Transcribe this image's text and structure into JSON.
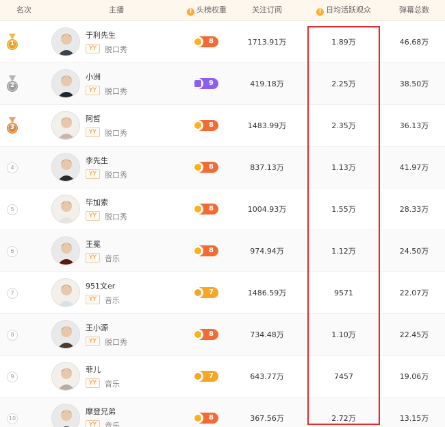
{
  "header": {
    "rank": "名次",
    "anchor": "主播",
    "weight": "头榜权重",
    "follow": "关注订阅",
    "viewers": "日均活跃观众",
    "danmu": "弹幕总数"
  },
  "colors": {
    "gold": "#e8a31c",
    "silver": "#9a9a9a",
    "bronze": "#d9853b",
    "highlight": "#e8262c"
  },
  "rows": [
    {
      "rank": "1",
      "medal": "gold",
      "name": "于利先生",
      "platform": "YY",
      "category": "脱口秀",
      "badge": "sun",
      "level": "8",
      "follow": "1713.91万",
      "viewers": "1.89万",
      "danmu": "46.68万"
    },
    {
      "rank": "2",
      "medal": "silver",
      "name": "小洲",
      "platform": "YY",
      "category": "脱口秀",
      "badge": "crown",
      "level": "9",
      "follow": "419.18万",
      "viewers": "2.25万",
      "danmu": "38.50万"
    },
    {
      "rank": "3",
      "medal": "bronze",
      "name": "阿哲",
      "platform": "YY",
      "category": "脱口秀",
      "badge": "sun",
      "level": "8",
      "follow": "1483.99万",
      "viewers": "2.35万",
      "danmu": "36.13万"
    },
    {
      "rank": "4",
      "medal": "",
      "name": "李先生",
      "platform": "YY",
      "category": "脱口秀",
      "badge": "sun",
      "level": "8",
      "follow": "837.13万",
      "viewers": "1.13万",
      "danmu": "41.97万"
    },
    {
      "rank": "5",
      "medal": "",
      "name": "毕加索",
      "platform": "YY",
      "category": "脱口秀",
      "badge": "sun",
      "level": "8",
      "follow": "1004.93万",
      "viewers": "1.55万",
      "danmu": "28.33万"
    },
    {
      "rank": "6",
      "medal": "",
      "name": "王冕",
      "platform": "YY",
      "category": "音乐",
      "badge": "sun",
      "level": "8",
      "follow": "974.94万",
      "viewers": "1.12万",
      "danmu": "24.50万"
    },
    {
      "rank": "7",
      "medal": "",
      "name": "951文er",
      "platform": "YY",
      "category": "音乐",
      "badge": "moon",
      "level": "7",
      "follow": "1486.59万",
      "viewers": "9571",
      "danmu": "22.07万"
    },
    {
      "rank": "8",
      "medal": "",
      "name": "王小源",
      "platform": "YY",
      "category": "脱口秀",
      "badge": "sun",
      "level": "8",
      "follow": "734.48万",
      "viewers": "1.10万",
      "danmu": "22.45万"
    },
    {
      "rank": "9",
      "medal": "",
      "name": "菲儿",
      "platform": "YY",
      "category": "音乐",
      "badge": "moon",
      "level": "7",
      "follow": "643.77万",
      "viewers": "7457",
      "danmu": "19.06万"
    },
    {
      "rank": "10",
      "medal": "",
      "name": "摩登兄弟",
      "platform": "YY",
      "category": "音乐",
      "badge": "sun",
      "level": "8",
      "follow": "367.56万",
      "viewers": "2.72万",
      "danmu": "13.15万"
    }
  ]
}
